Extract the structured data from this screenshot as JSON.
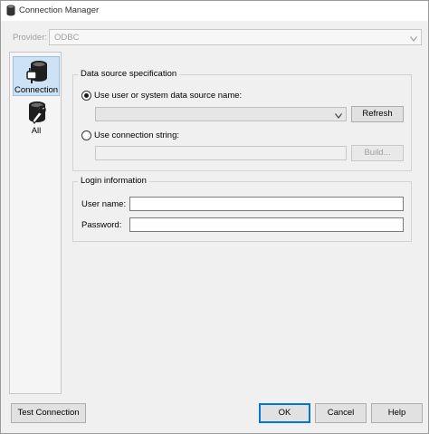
{
  "window": {
    "title": "Connection Manager"
  },
  "provider": {
    "label": "Provider:",
    "value": "ODBC"
  },
  "nav": {
    "items": [
      {
        "label": "Connection",
        "icon": "plug-database-icon",
        "selected": true
      },
      {
        "label": "All",
        "icon": "wrench-database-icon",
        "selected": false
      }
    ]
  },
  "data_source": {
    "legend": "Data source specification",
    "use_dsn_label": "Use user or system data source name:",
    "dsn_value": "",
    "refresh_label": "Refresh",
    "use_conn_string_label": "Use connection string:",
    "conn_string_value": "",
    "build_label": "Build..."
  },
  "login": {
    "legend": "Login information",
    "username_label": "User name:",
    "username_value": "",
    "password_label": "Password:",
    "password_value": ""
  },
  "footer": {
    "test_connection_label": "Test Connection",
    "ok_label": "OK",
    "cancel_label": "Cancel",
    "help_label": "Help"
  },
  "colors": {
    "selection_bg": "#cde2f5",
    "default_button_border": "#0078d7"
  }
}
